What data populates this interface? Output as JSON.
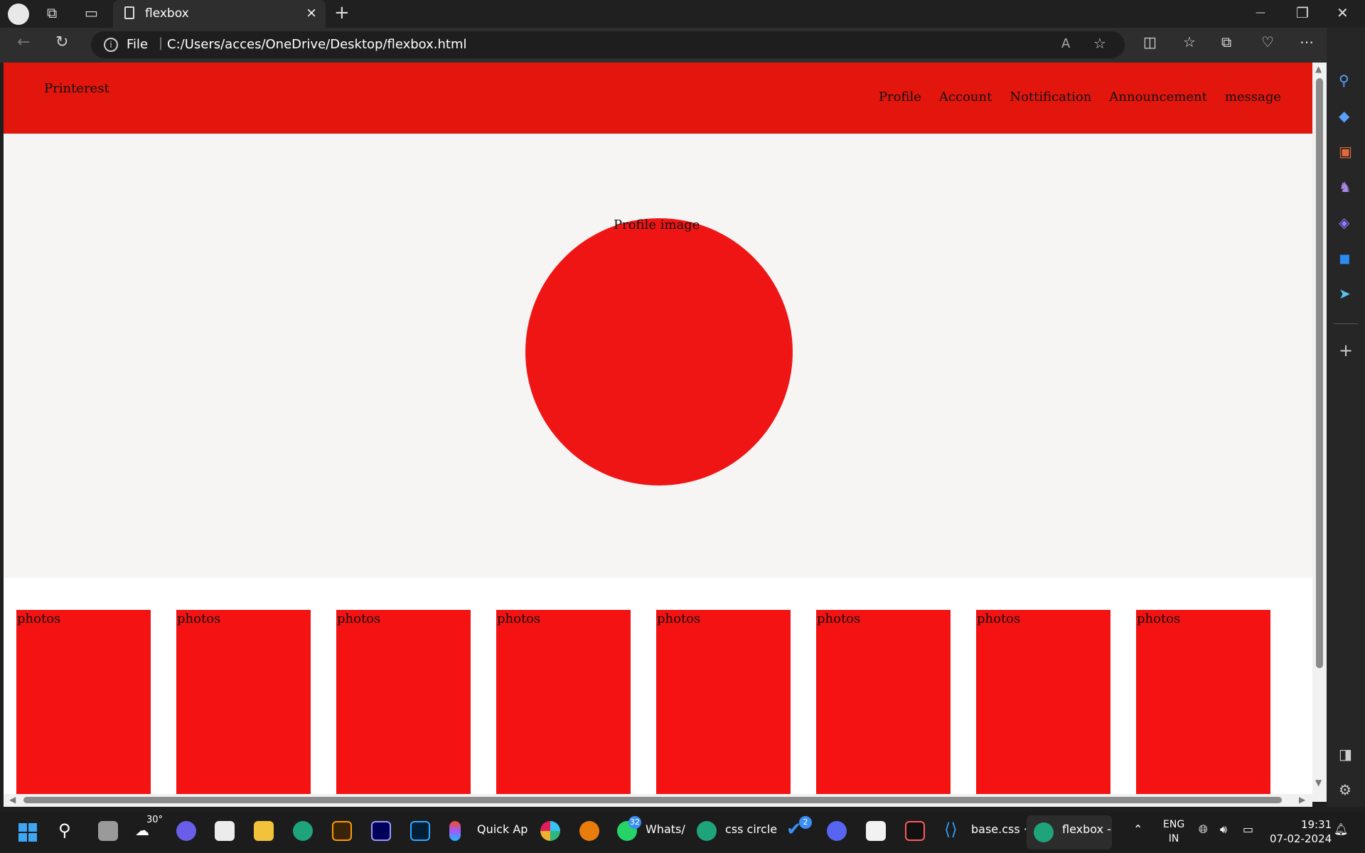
{
  "browser": {
    "tab": {
      "title": "flexbox",
      "close": "×"
    },
    "new_tab": "+",
    "window_controls": {
      "minimize": "—",
      "restore": "❐",
      "close": "✕"
    },
    "address": {
      "scheme_label": "File",
      "separator": "|",
      "url": "C:/Users/acces/OneDrive/Desktop/flexbox.html"
    },
    "icons": [
      "back-icon",
      "refresh-icon",
      "read-aloud-icon",
      "favorite-icon",
      "split-screen-icon",
      "favorites-icon",
      "collections-icon",
      "health-icon",
      "more-icon",
      "copilot-icon"
    ]
  },
  "page": {
    "brand": "Printerest",
    "nav": [
      "Profile",
      "Account",
      "Nottification",
      "Announcement",
      "message"
    ],
    "profile_label": "Profile image",
    "photos": [
      "photos",
      "photos",
      "photos",
      "photos",
      "photos",
      "photos",
      "photos",
      "photos"
    ],
    "colors": {
      "header": "#e2160d",
      "circle": "#ef1515",
      "photo": "#f41212",
      "hero": "#f6f5f4"
    }
  },
  "sidebar": {
    "icons": [
      "search-icon",
      "shopping-icon",
      "tools-icon",
      "games-icon",
      "office-icon",
      "outlook-icon",
      "send-icon",
      "add-icon",
      "sidebar-toggle-icon",
      "settings-icon"
    ]
  },
  "taskbar": {
    "weather": "30°",
    "apps": [
      {
        "label": "Quick Ap"
      },
      {
        "label": "Whats/",
        "badge": "32"
      },
      {
        "label": "css circle"
      },
      {
        "badge": "2"
      },
      {
        "label": "base.css ·"
      },
      {
        "label": "flexbox -"
      }
    ],
    "language": {
      "line1": "ENG",
      "line2": "IN"
    },
    "time": "19:31",
    "date": "07-02-2024"
  }
}
